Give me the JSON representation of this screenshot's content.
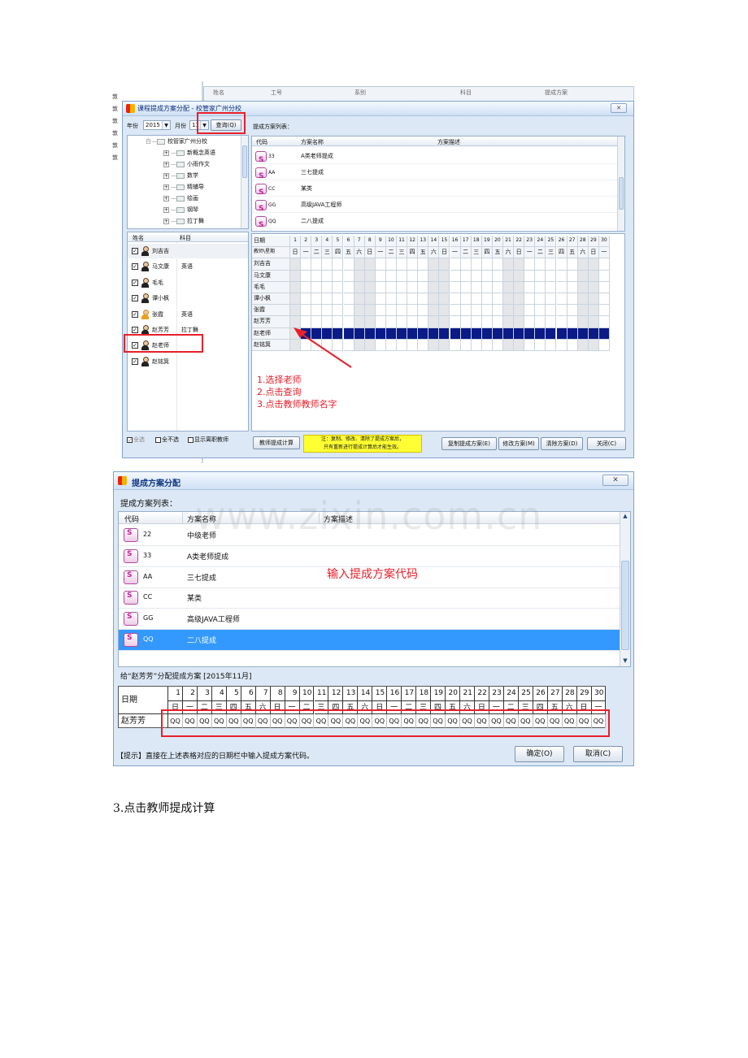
{
  "left_margin_fragments": [
    "敦",
    "敦",
    "敦",
    "敦",
    "敦",
    "敦"
  ],
  "bg_header_cols": [
    "姓名",
    "工号",
    "系别",
    "科目",
    "提成方案"
  ],
  "w1": {
    "title": "课程提成方案分配 - 校管家广州分校",
    "year_label": "年份",
    "year_value": "2015",
    "month_label": "月份",
    "month_value": "11",
    "query_button": "查询(Q)",
    "tree": {
      "root": "校管家广州分校",
      "children": [
        "新概念英语",
        "小雨作文",
        "数学",
        "精辅导",
        "绘画",
        "钢琴",
        "拉丁舞"
      ]
    },
    "teacher_list": {
      "col_name": "姓名",
      "col_subject": "科目",
      "rows": [
        {
          "name": "刘吉吉",
          "subject": ""
        },
        {
          "name": "马文康",
          "subject": "英语"
        },
        {
          "name": "毛毛",
          "subject": ""
        },
        {
          "name": "谭小枫",
          "subject": ""
        },
        {
          "name": "张霞",
          "subject": "英语"
        },
        {
          "name": "赵芳芳",
          "subject": "拉丁舞"
        },
        {
          "name": "赵老师",
          "subject": ""
        },
        {
          "name": "赵铭箕",
          "subject": ""
        }
      ]
    },
    "bottom_opts": [
      "全选",
      "全不选",
      "显示离职教师"
    ],
    "calc_button": "教师提成计算",
    "note_line1": "注：复制、修改、清除了提成方案后，",
    "note_line2": "只有重新进行提成计算后才能生效。",
    "copy_button": "复制提成方案(E)",
    "modify_button": "修改方案(M)",
    "clear_button": "清除方案(D)",
    "close_button": "关闭(C)",
    "plan_list_label": "提成方案列表：",
    "plan_cols": [
      "代码",
      "方案名称",
      "方案描述"
    ],
    "plans": [
      {
        "code": "33",
        "name": "A类老师提成"
      },
      {
        "code": "AA",
        "name": "三七提成"
      },
      {
        "code": "CC",
        "name": "某类"
      },
      {
        "code": "GG",
        "name": "高级JAVA工程师"
      },
      {
        "code": "QQ",
        "name": "二八提成"
      }
    ],
    "cal_row1_label": "日期",
    "cal_row2_label": "教师\\星期",
    "cal_teachers": [
      "刘吉吉",
      "马文康",
      "毛毛",
      "谭小枫",
      "张霞",
      "赵芳芳",
      "赵老师",
      "赵铭箕"
    ],
    "highlight_teacher_index": 6,
    "annotation_lines": [
      "1.选择老师",
      "2.点击查询",
      "3.点击教师教师名字"
    ]
  },
  "days": [
    "1",
    "2",
    "3",
    "4",
    "5",
    "6",
    "7",
    "8",
    "9",
    "10",
    "11",
    "12",
    "13",
    "14",
    "15",
    "16",
    "17",
    "18",
    "19",
    "20",
    "21",
    "22",
    "23",
    "24",
    "25",
    "26",
    "27",
    "28",
    "29",
    "30"
  ],
  "weekdays": [
    "日",
    "一",
    "二",
    "三",
    "四",
    "五",
    "六",
    "日",
    "一",
    "二",
    "三",
    "四",
    "五",
    "六",
    "日",
    "一",
    "二",
    "三",
    "四",
    "五",
    "六",
    "日",
    "一",
    "二",
    "三",
    "四",
    "五",
    "六",
    "日",
    "一"
  ],
  "weekend_days": [
    1,
    7,
    8,
    14,
    15,
    21,
    22,
    28,
    29
  ],
  "w2": {
    "title": "提成方案分配",
    "plan_list_label": "提成方案列表：",
    "cols": [
      "代码",
      "方案名称",
      "方案描述"
    ],
    "plans": [
      {
        "code": "22",
        "name": "中级老师"
      },
      {
        "code": "33",
        "name": "A类老师提成"
      },
      {
        "code": "AA",
        "name": "三七提成"
      },
      {
        "code": "CC",
        "name": "某类"
      },
      {
        "code": "GG",
        "name": "高级JAVA工程师"
      },
      {
        "code": "QQ",
        "name": "二八提成"
      }
    ],
    "selected_index": 5,
    "annotation": "输入提成方案代码",
    "assign_label": "给“赵芳芳”分配提成方案 [2015年11月]",
    "date_label": "日期",
    "teacher_name": "赵芳芳",
    "cell_code": "QQ",
    "hint": "【提示】直接在上述表格对应的日期栏中输入提成方案代码。",
    "ok_button": "确定(O)",
    "cancel_button": "取消(C)"
  },
  "watermark": "www.zixin.com.cn",
  "step_text": "3.点击教师提成计算",
  "colors": {
    "red": "#e8202a",
    "navy": "#0a1a86",
    "select": "#3399ff",
    "annot": "#e8202a"
  }
}
